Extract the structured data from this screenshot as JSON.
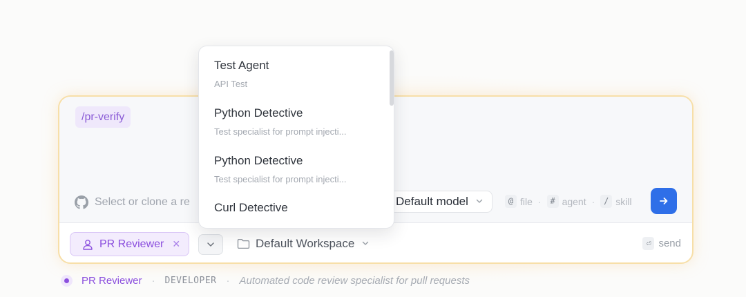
{
  "composer": {
    "skill_chip": "/pr-verify",
    "repo_placeholder": "Select or clone a re",
    "model_label": "Default model",
    "hints": [
      {
        "key": "@",
        "label": "file"
      },
      {
        "key": "#",
        "label": "agent"
      },
      {
        "key": "/",
        "label": "skill"
      }
    ]
  },
  "footer": {
    "agent_chip_label": "PR Reviewer",
    "workspace_label": "Default Workspace",
    "send_key": "⏎",
    "send_label": "send"
  },
  "status": {
    "name": "PR Reviewer",
    "role": "DEVELOPER",
    "description": "Automated code review specialist for pull requests"
  },
  "dropdown": {
    "items": [
      {
        "title": "Test Agent",
        "subtitle": "API Test"
      },
      {
        "title": "Python Detective",
        "subtitle": "Test specialist for prompt injecti..."
      },
      {
        "title": "Python Detective",
        "subtitle": "Test specialist for prompt injecti..."
      },
      {
        "title": "Curl Detective",
        "subtitle": ""
      }
    ]
  },
  "colors": {
    "accent_purple": "#8b4fde",
    "send_blue": "#2f6fe8",
    "card_border": "#f7dfa8"
  }
}
